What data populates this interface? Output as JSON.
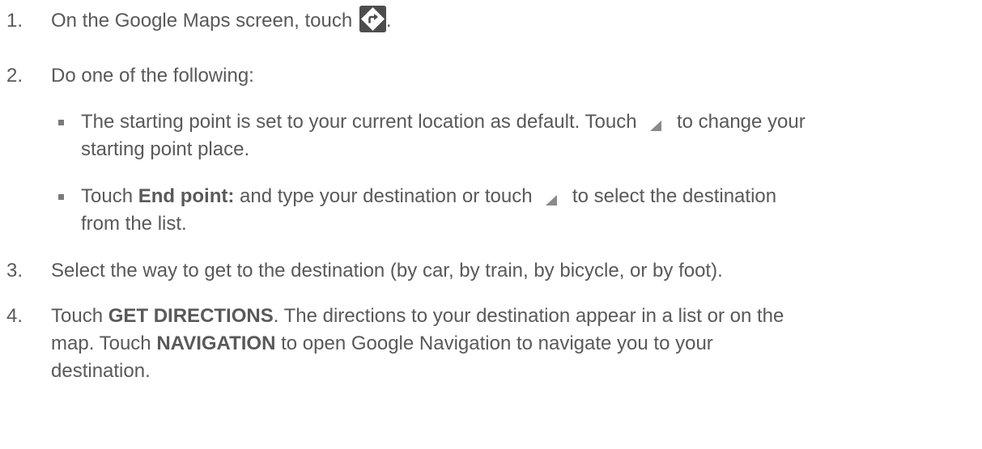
{
  "steps": [
    {
      "num": "1.",
      "before": "On the Google Maps screen, touch ",
      "after": ".",
      "icon": "directions-icon"
    },
    {
      "num": "2.",
      "text": "Do one of the following:",
      "bullets": [
        {
          "before": "The starting point is set to your current location as default. Touch ",
          "after": " to change your",
          "line2": "starting point place.",
          "icon": "dropdown-triangle-icon"
        },
        {
          "before": "Touch ",
          "bold": "End point:",
          "mid": " and type your destination or touch ",
          "after": " to select the destination",
          "line2": "from the list.",
          "icon": "dropdown-triangle-icon"
        }
      ]
    },
    {
      "num": "3.",
      "text": "Select the way to get to the destination (by car, by train, by bicycle, or by foot)."
    },
    {
      "num": "4.",
      "before": "Touch ",
      "bold1": "GET DIRECTIONS",
      "mid1": ". The directions to your destination appear in a list or on the",
      "line2a": "map. Touch ",
      "bold2": "NAVIGATION",
      "line2b": " to open Google Navigation to navigate you to your",
      "line3": "destination."
    }
  ]
}
